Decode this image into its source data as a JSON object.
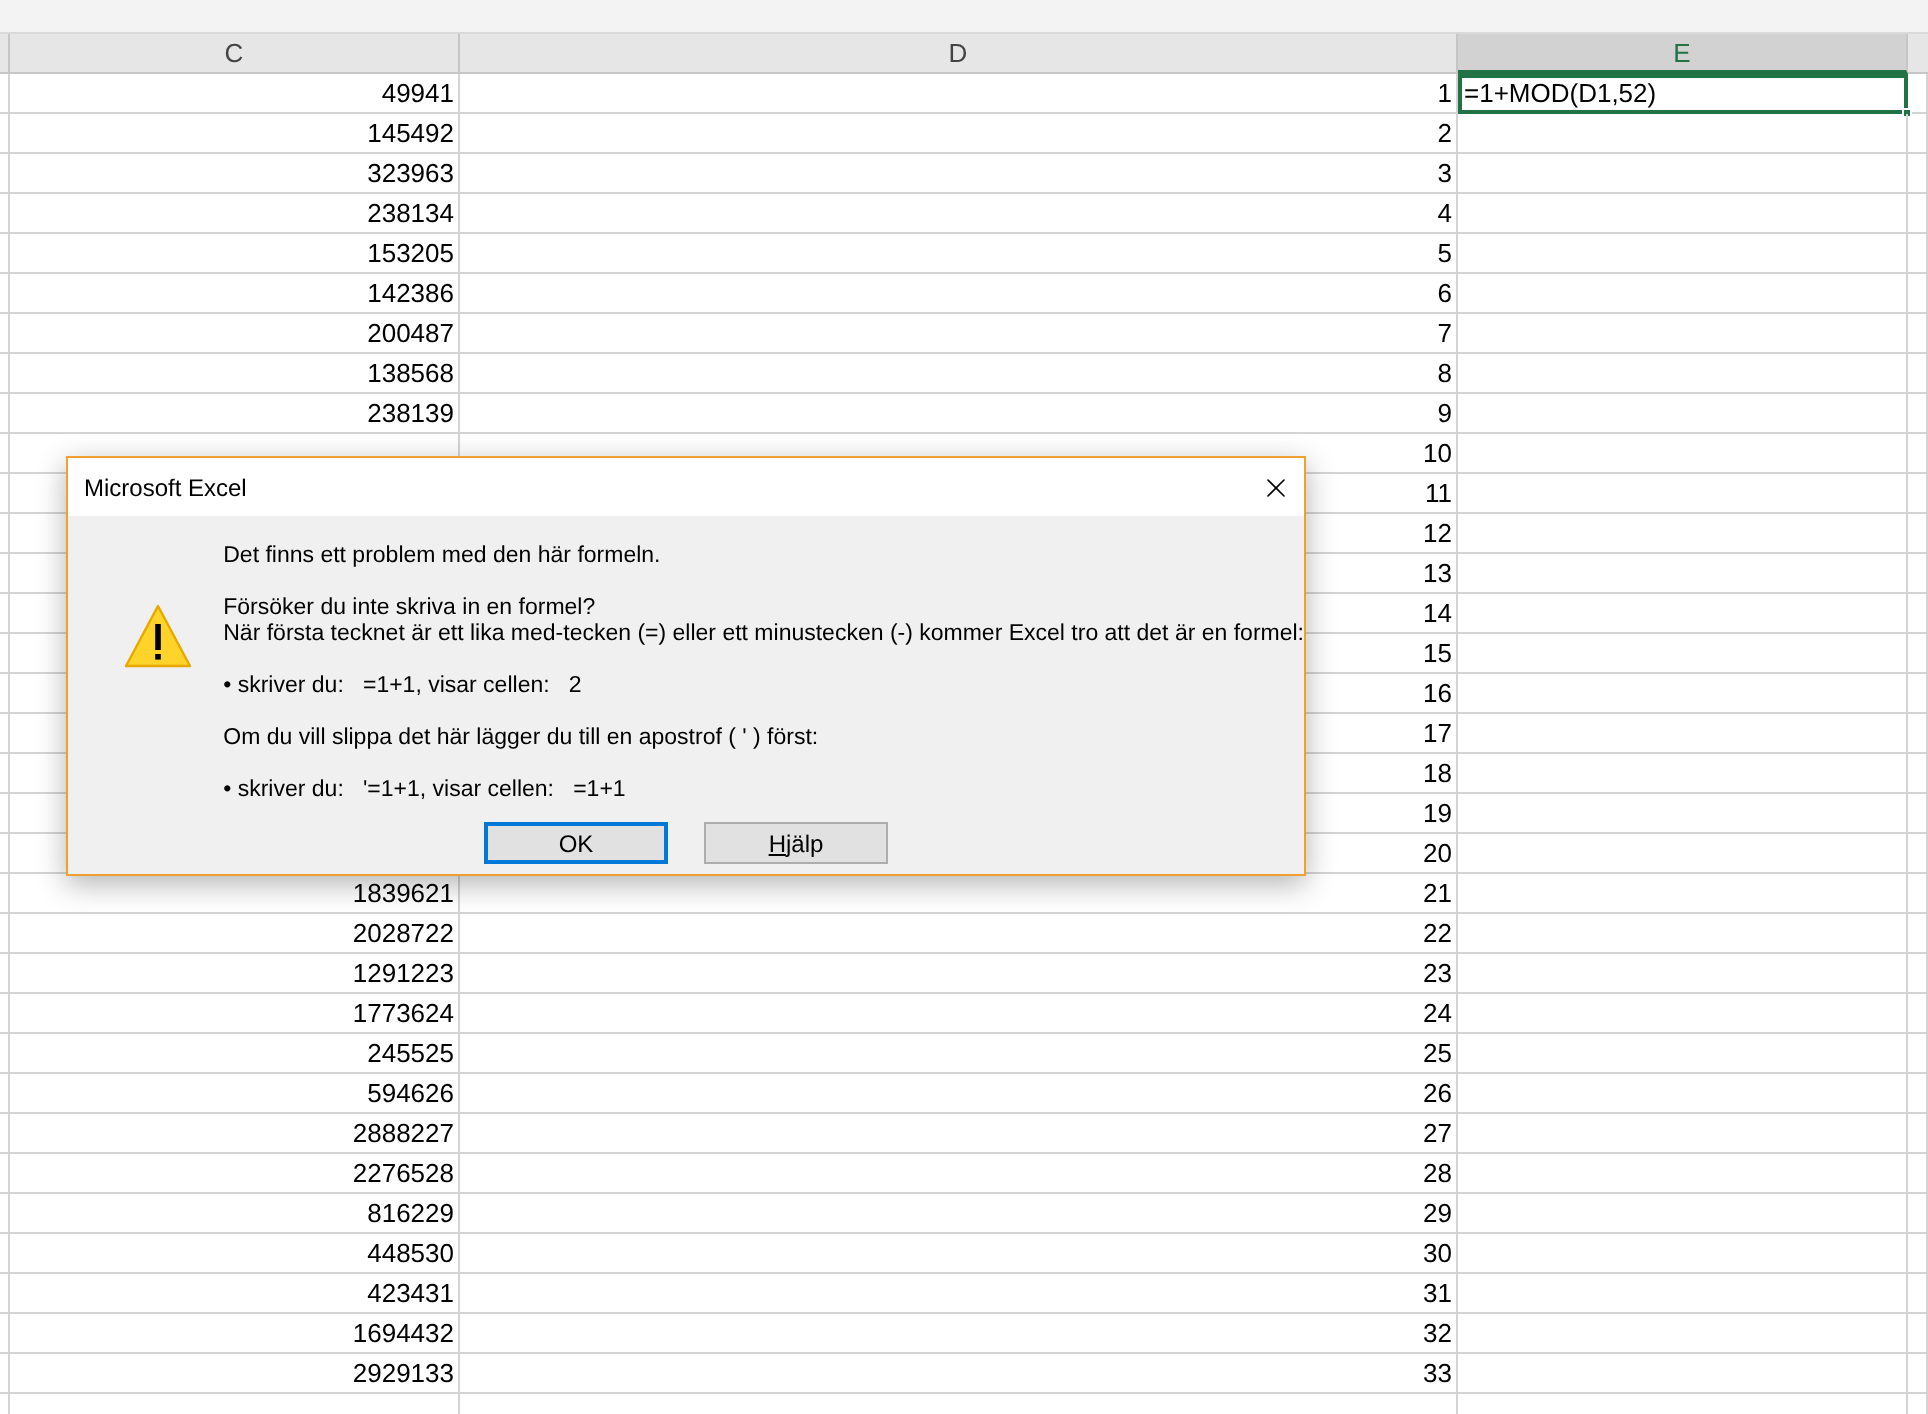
{
  "sheet": {
    "columns": [
      {
        "label": "C",
        "selected": false
      },
      {
        "label": "D",
        "selected": false
      },
      {
        "label": "E",
        "selected": true
      }
    ],
    "rows": [
      {
        "c": "49941",
        "d": "1",
        "e": "=1+MOD(D1,52)",
        "active": true
      },
      {
        "c": "145492",
        "d": "2",
        "active": false
      },
      {
        "c": "323963",
        "d": "3",
        "active": false
      },
      {
        "c": "238134",
        "d": "4",
        "active": false
      },
      {
        "c": "153205",
        "d": "5",
        "active": false
      },
      {
        "c": "142386",
        "d": "6",
        "active": false
      },
      {
        "c": "200487",
        "d": "7",
        "active": false
      },
      {
        "c": "138568",
        "d": "8",
        "active": false
      },
      {
        "c": "238139",
        "d": "9",
        "active": false
      },
      {
        "d": "10",
        "active": false
      },
      {
        "d": "11",
        "active": false
      },
      {
        "d": "12",
        "active": false
      },
      {
        "d": "13",
        "active": false
      },
      {
        "d": "14",
        "active": false
      },
      {
        "d": "15",
        "active": false
      },
      {
        "d": "16",
        "active": false
      },
      {
        "d": "17",
        "active": false
      },
      {
        "d": "18",
        "active": false
      },
      {
        "d": "19",
        "active": false
      },
      {
        "d": "20",
        "active": false
      },
      {
        "c": "1839621",
        "d": "21",
        "active": false
      },
      {
        "c": "2028722",
        "d": "22",
        "active": false
      },
      {
        "c": "1291223",
        "d": "23",
        "active": false
      },
      {
        "c": "1773624",
        "d": "24",
        "active": false
      },
      {
        "c": "245525",
        "d": "25",
        "active": false
      },
      {
        "c": "594626",
        "d": "26",
        "active": false
      },
      {
        "c": "2888227",
        "d": "27",
        "active": false
      },
      {
        "c": "2276528",
        "d": "28",
        "active": false
      },
      {
        "c": "816229",
        "d": "29",
        "active": false
      },
      {
        "c": "448530",
        "d": "30",
        "active": false
      },
      {
        "c": "423431",
        "d": "31",
        "active": false
      },
      {
        "c": "1694432",
        "d": "32",
        "active": false
      },
      {
        "c": "2929133",
        "d": "33",
        "active": false
      }
    ]
  },
  "dialog": {
    "title": "Microsoft Excel",
    "paragraphs": [
      [
        "Det finns ett problem med den här formeln."
      ],
      [
        "Försöker du inte skriva in en formel?",
        "När första tecknet är ett lika med-tecken (=) eller ett minustecken (-) kommer Excel tro att det är en formel:"
      ],
      [
        "• skriver du:   =1+1, visar cellen:   2"
      ],
      [
        "Om du vill slippa det här lägger du till en apostrof ( ' ) först:"
      ],
      [
        "• skriver du:   '=1+1, visar cellen:   =1+1"
      ]
    ],
    "buttons": [
      {
        "label": [
          {
            "text": "OK",
            "underlined": false
          }
        ],
        "default": true
      },
      {
        "label": [
          {
            "text": "H",
            "underlined": true
          },
          {
            "text": "jälp",
            "underlined": false
          }
        ],
        "default": false
      }
    ]
  }
}
